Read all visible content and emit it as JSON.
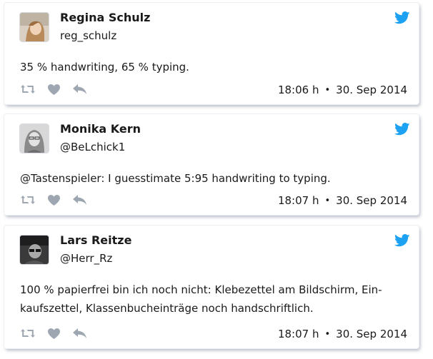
{
  "tweets": [
    {
      "name": "Regina Schulz",
      "handle": "reg_schulz",
      "text": "35 % handwriting, 65 % typing.",
      "time": "18:06 h",
      "separator": "•",
      "date": "30. Sep 2014"
    },
    {
      "name": "Monika Kern",
      "handle": "@BeLchick1",
      "text": "@Tastenspieler: I guesstimate 5:95 handwriting to typing.",
      "time": "18:07 h",
      "separator": "•",
      "date": "30. Sep 2014"
    },
    {
      "name": "Lars Reitze",
      "handle": "@Herr_Rz",
      "text": "100 % papierfrei bin ich noch nicht: Klebezettel am Bildschirm, Ein­kaufszettel, Klassenbucheinträge noch handschriftlich.",
      "time": "18:07 h",
      "separator": "•",
      "date": "30. Sep 2014"
    }
  ],
  "icons": {
    "brand": "twitter-bird-icon",
    "actions": [
      "retweet-icon",
      "like-heart-icon",
      "reply-icon"
    ]
  },
  "colors": {
    "twitter_blue": "#1da1f2",
    "action_gray": "#9ea7b1"
  }
}
